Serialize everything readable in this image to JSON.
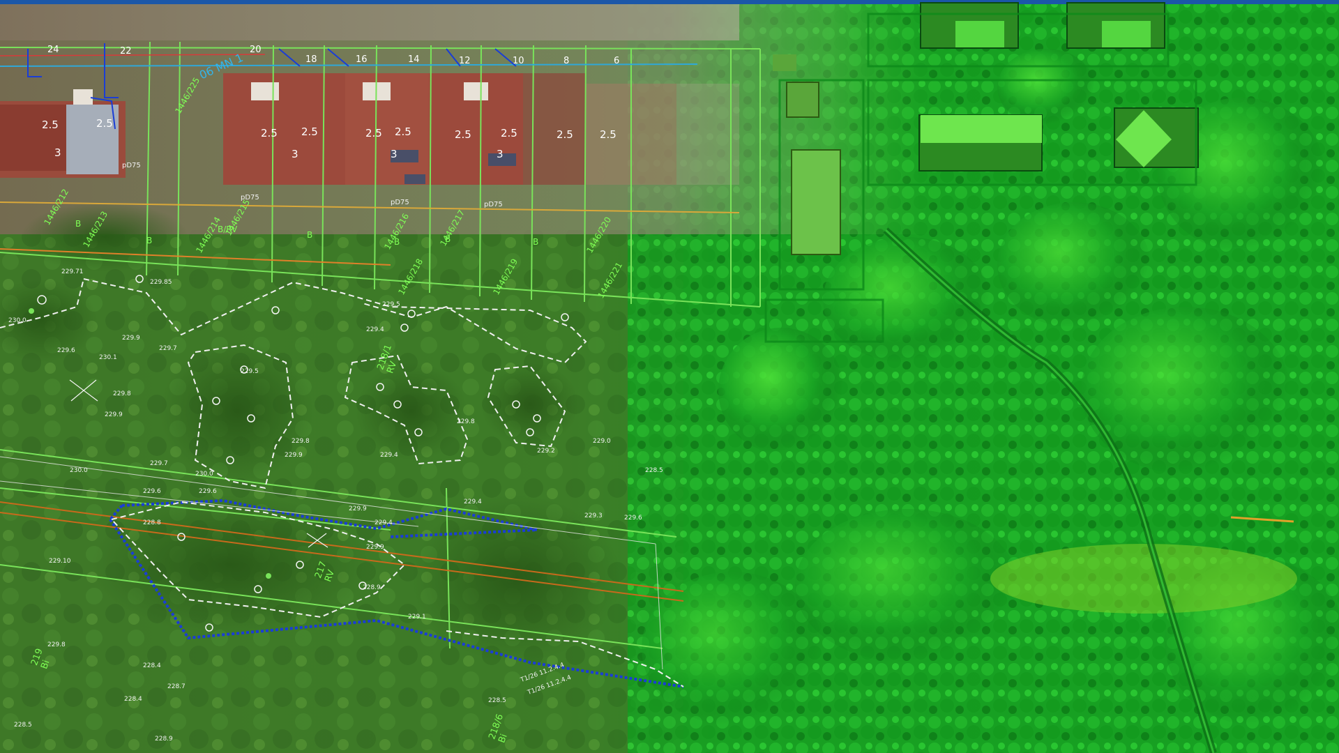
{
  "colors": {
    "top_bar": "#1b57a8",
    "lidar_green": "#1fbf2e",
    "lidar_dark": "#0e7a18",
    "lidar_bright": "#5dff3c",
    "photo_green": "#3f7a28",
    "roof_red": "#9c4a3c",
    "parcel_line": "#79e35a",
    "utility_blue": "#1a3dd6",
    "gas_orange": "#d07a1c",
    "contour_white": "#f0f0f0",
    "height_label": "#f2f2f2",
    "parcel_label": "#7fff55"
  },
  "house_numbers": [
    "24",
    "22",
    "20",
    "18",
    "16",
    "14",
    "12",
    "10",
    "8",
    "6"
  ],
  "storey_labels": [
    "2.5",
    "2.5",
    "3",
    "2.5",
    "2.5",
    "3",
    "2.5",
    "2.5",
    "3",
    "2.5",
    "2.5",
    "3",
    "2.5",
    "2.5"
  ],
  "street_label": "06 MN 1",
  "pipe_labels": [
    "pD75",
    "pD75",
    "pD75",
    "pD75"
  ],
  "parcel_ids": [
    "1446/212",
    "1446/213",
    "1446/214",
    "1446/215",
    "1446/216",
    "1446/217",
    "1446/218",
    "1446/219",
    "1446/220",
    "1446/221",
    "1446/225"
  ],
  "land_use_codes": [
    "B",
    "B",
    "B/RV",
    "B",
    "B",
    "B",
    "B"
  ],
  "field_parcels": [
    {
      "id": "218/1",
      "use": "RV"
    },
    {
      "id": "217",
      "use": "RV"
    },
    {
      "id": "219",
      "use": "Bi"
    },
    {
      "id": "218/6",
      "use": "Bi"
    }
  ],
  "spot_heights": [
    "229.71",
    "229.85",
    "230.0",
    "229.4",
    "229.5",
    "229.9",
    "230.1",
    "229.7",
    "229.6",
    "229.8",
    "229.9",
    "229.8",
    "229.4",
    "229.9",
    "230.0",
    "229.8",
    "229.2",
    "228.5",
    "229.6",
    "229.4",
    "229.9",
    "228.8",
    "229.7",
    "229.6",
    "229.4",
    "229.3",
    "229.6",
    "229.9",
    "228.9",
    "229.1",
    "228.4",
    "228.7",
    "229.8",
    "228.4",
    "228.5",
    "228.9",
    "228.5",
    "229.10",
    "230.0",
    "229.5",
    "229.0"
  ],
  "cable_labels": [
    "T1/26 11.2.4.4",
    "T1/26 11.2.4.4"
  ],
  "icons": [
    "tree-symbol-icon",
    "survey-point-icon",
    "crosshair-icon"
  ]
}
